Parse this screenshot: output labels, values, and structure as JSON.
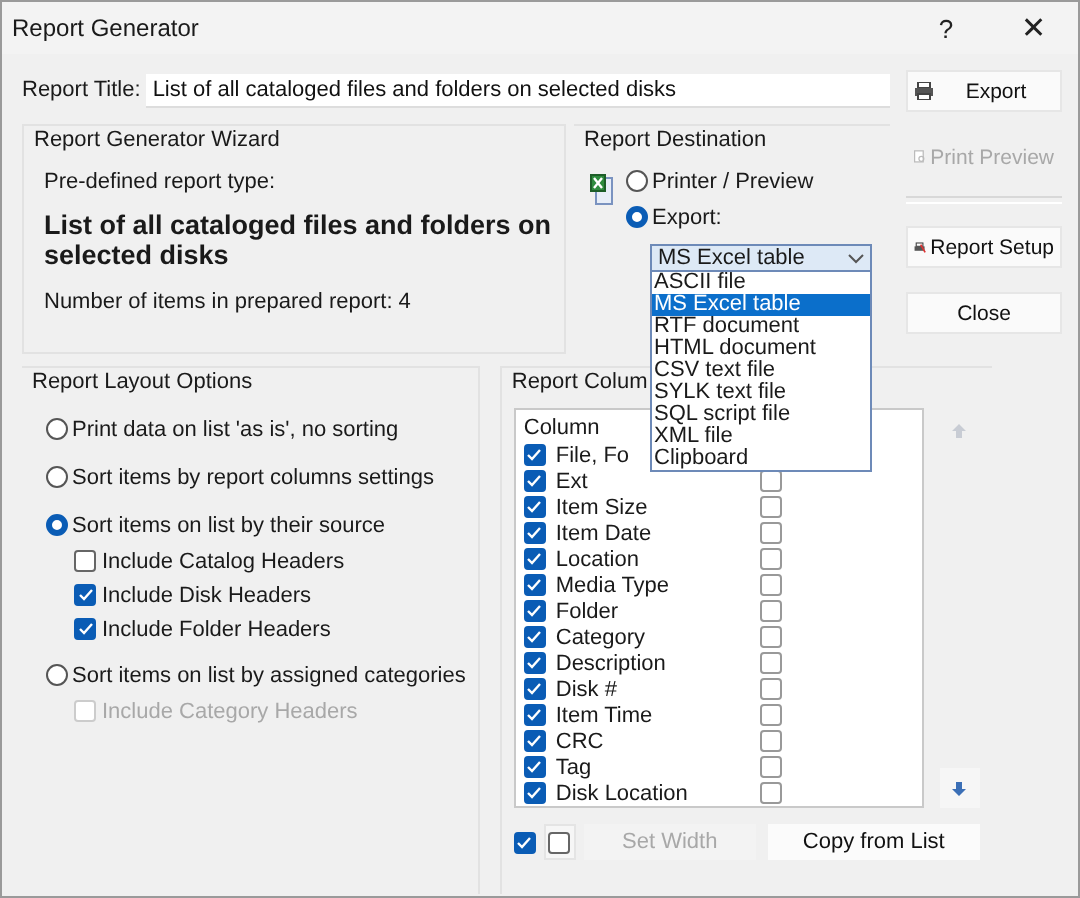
{
  "window": {
    "title": "Report Generator",
    "help": "?",
    "close": "✕"
  },
  "report_title": {
    "label": "Report Title:",
    "value": "List of all cataloged files and folders on selected disks"
  },
  "wizard": {
    "title": "Report Generator Wizard",
    "type_label": "Pre-defined report type:",
    "type_name": "List of all cataloged files and folders on selected disks",
    "count": "Number of items in prepared report: 4"
  },
  "destination": {
    "title": "Report Destination",
    "options": [
      {
        "label": "Printer / Preview",
        "selected": false
      },
      {
        "label": "Export:",
        "selected": true
      }
    ],
    "format": {
      "value": "MS Excel table",
      "expanded": true,
      "items": [
        {
          "label": "ASCII file",
          "selected": false
        },
        {
          "label": "MS Excel table",
          "selected": true
        },
        {
          "label": "RTF document",
          "selected": false
        },
        {
          "label": "HTML document",
          "selected": false
        },
        {
          "label": "CSV text file",
          "selected": false
        },
        {
          "label": "SYLK text file",
          "selected": false
        },
        {
          "label": "SQL script file",
          "selected": false
        },
        {
          "label": "XML file",
          "selected": false
        },
        {
          "label": "Clipboard",
          "selected": false
        }
      ]
    }
  },
  "layout_options": {
    "title": "Report Layout Options",
    "items": [
      {
        "kind": "radio",
        "label": "Print data on list 'as is', no sorting",
        "selected": false,
        "disabled": false
      },
      {
        "kind": "radio",
        "label": "Sort items by report columns settings",
        "selected": false,
        "disabled": false
      },
      {
        "kind": "radio",
        "label": "Sort items on list by their source",
        "selected": true,
        "disabled": false
      },
      {
        "kind": "checkbox",
        "label": "Include Catalog Headers",
        "checked": false,
        "disabled": false
      },
      {
        "kind": "checkbox",
        "label": "Include Disk Headers",
        "checked": true,
        "disabled": false
      },
      {
        "kind": "checkbox",
        "label": "Include Folder Headers",
        "checked": true,
        "disabled": false
      },
      {
        "kind": "radio",
        "label": "Sort items on list by assigned categories",
        "selected": false,
        "disabled": false
      },
      {
        "kind": "checkbox",
        "label": "Include Category Headers",
        "checked": false,
        "disabled": true
      }
    ]
  },
  "columns": {
    "title": "Report Colum",
    "header": "Column",
    "rows": [
      {
        "name": "File, Fo",
        "checked": true
      },
      {
        "name": "Ext",
        "checked": true,
        "flag": false
      },
      {
        "name": "Item Size",
        "checked": true,
        "flag": false
      },
      {
        "name": "Item Date",
        "checked": true,
        "flag": false
      },
      {
        "name": "Location",
        "checked": true,
        "flag": false
      },
      {
        "name": "Media Type",
        "checked": true,
        "flag": false
      },
      {
        "name": "Folder",
        "checked": true,
        "flag": false
      },
      {
        "name": "Category",
        "checked": true,
        "flag": false
      },
      {
        "name": "Description",
        "checked": true,
        "flag": false
      },
      {
        "name": "Disk #",
        "checked": true,
        "flag": false
      },
      {
        "name": "Item Time",
        "checked": true,
        "flag": false
      },
      {
        "name": "CRC",
        "checked": true,
        "flag": false
      },
      {
        "name": "Tag",
        "checked": true,
        "flag": false
      },
      {
        "name": "Disk Location",
        "checked": true,
        "flag": false
      }
    ],
    "all_checked": true,
    "flag_toggle": false,
    "set_width": {
      "label": "Set Width",
      "disabled": true
    },
    "copy": {
      "label": "Copy from List",
      "disabled": false
    }
  },
  "buttons": [
    {
      "kind": "export",
      "label": "Export",
      "disabled": false
    },
    {
      "kind": "preview",
      "label": "Print Preview",
      "disabled": true
    },
    {
      "kind": "setup",
      "label": "Report Setup",
      "disabled": false
    },
    {
      "kind": "close",
      "label": "Close",
      "disabled": false
    }
  ]
}
